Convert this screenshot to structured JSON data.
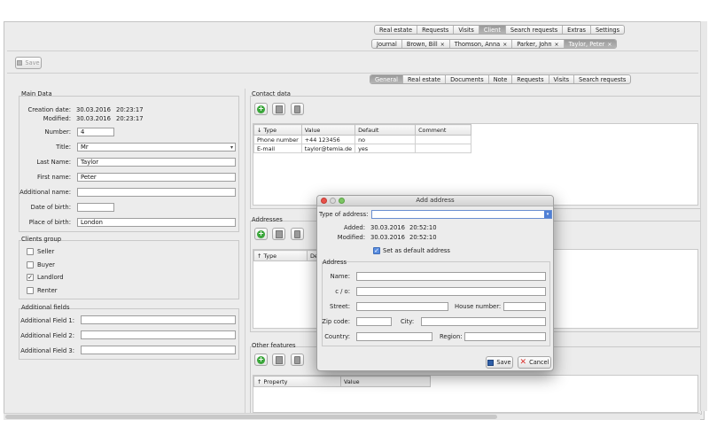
{
  "top_tabs": [
    "Real estate",
    "Requests",
    "Visits",
    "Client",
    "Search requests",
    "Extras",
    "Settings"
  ],
  "top_tabs_active": "Client",
  "client_tabs": [
    {
      "label": "Journal",
      "closable": false
    },
    {
      "label": "Brown, Bill",
      "closable": true
    },
    {
      "label": "Thomson, Anna",
      "closable": true
    },
    {
      "label": "Parker, John",
      "closable": true
    },
    {
      "label": "Taylor, Peter",
      "closable": true
    }
  ],
  "client_tabs_active": "Taylor, Peter",
  "close_glyph": "×",
  "toolbar": {
    "save_label": "Save"
  },
  "sub_tabs": [
    "General",
    "Real estate",
    "Documents",
    "Note",
    "Requests",
    "Visits",
    "Search requests"
  ],
  "sub_tabs_active": "General",
  "main_data": {
    "title": "Main Data",
    "creation_date_label": "Creation date:",
    "creation_date": "30.03.2016",
    "creation_time": "20:23:17",
    "modified_label": "Modified:",
    "modified_date": "30.03.2016",
    "modified_time": "20:23:17",
    "number_label": "Number:",
    "number": "4",
    "title_label": "Title:",
    "title_value": "Mr",
    "last_name_label": "Last Name:",
    "last_name": "Taylor",
    "first_name_label": "First name:",
    "first_name": "Peter",
    "additional_name_label": "Additional name:",
    "additional_name": "",
    "date_of_birth_label": "Date of birth:",
    "date_of_birth": "",
    "place_of_birth_label": "Place of birth:",
    "place_of_birth": "London"
  },
  "clients_group": {
    "title": "Clients group",
    "items": [
      {
        "label": "Seller",
        "checked": false
      },
      {
        "label": "Buyer",
        "checked": false
      },
      {
        "label": "Landlord",
        "checked": true
      },
      {
        "label": "Renter",
        "checked": false
      }
    ],
    "check_glyph": "✓"
  },
  "additional_fields": {
    "title": "Additional fields",
    "field1_label": "Additional Field 1:",
    "field2_label": "Additional Field 2:",
    "field3_label": "Additional Field 3:"
  },
  "contact_data": {
    "title": "Contact data",
    "columns": [
      "↓ Type",
      "Value",
      "Default",
      "Comment"
    ],
    "rows": [
      [
        "Phone number",
        "+44 123456",
        "no",
        ""
      ],
      [
        "E-mail",
        "taylor@temia.de",
        "yes",
        ""
      ]
    ]
  },
  "addresses": {
    "title": "Addresses",
    "columns": [
      "↑ Type",
      "De"
    ]
  },
  "other_features": {
    "title": "Other features",
    "columns": [
      "↑ Property",
      "Value"
    ]
  },
  "dialog": {
    "title": "Add address",
    "type_label": "Type of address:",
    "type_value": "",
    "added_label": "Added:",
    "added_date": "30.03.2016",
    "added_time": "20:52:10",
    "modified_label": "Modified:",
    "modified_date": "30.03.2016",
    "modified_time": "20:52:10",
    "default_label": "Set as default address",
    "default_checked": true,
    "address_group_title": "Address",
    "name_label": "Name:",
    "co_label": "c / o:",
    "street_label": "Street:",
    "house_number_label": "House number:",
    "zip_label": "Zip code:",
    "city_label": "City:",
    "country_label": "Country:",
    "region_label": "Region:",
    "save_label": "Save",
    "cancel_label": "Cancel"
  },
  "colors": {
    "active_tab": "#a8a8a8",
    "add_icon_green": "#3aa63a",
    "cancel_red": "#d9302c",
    "save_blue": "#2f5fa8"
  }
}
